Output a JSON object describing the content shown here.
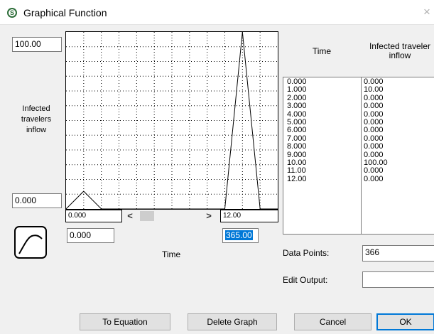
{
  "window": {
    "title": "Graphical Function",
    "app_icon_glyph": "S",
    "app_icon_name": "stella-s-icon",
    "close_glyph": "×"
  },
  "graph": {
    "y_max": "100.00",
    "y_min": "0.000",
    "y_label": "Infected travelers inflow",
    "x_label": "Time",
    "x_min_field": "0.000",
    "x_max_field": "365.00",
    "scroll_left_value": "0.000",
    "scroll_right_value": "12.00",
    "scroll_left_arrow": "<",
    "scroll_right_arrow": ">"
  },
  "table": {
    "col_time": "Time",
    "col_value": "Infected traveler inflow",
    "rows": [
      {
        "time": "0.000",
        "value": "0.000"
      },
      {
        "time": "1.000",
        "value": "10.00"
      },
      {
        "time": "2.000",
        "value": "0.000"
      },
      {
        "time": "3.000",
        "value": "0.000"
      },
      {
        "time": "4.000",
        "value": "0.000"
      },
      {
        "time": "5.000",
        "value": "0.000"
      },
      {
        "time": "6.000",
        "value": "0.000"
      },
      {
        "time": "7.000",
        "value": "0.000"
      },
      {
        "time": "8.000",
        "value": "0.000"
      },
      {
        "time": "9.000",
        "value": "0.000"
      },
      {
        "time": "10.00",
        "value": "100.00"
      },
      {
        "time": "11.00",
        "value": "0.000"
      },
      {
        "time": "12.00",
        "value": "0.000"
      }
    ]
  },
  "fields": {
    "data_points_label": "Data Points:",
    "data_points_value": "366",
    "edit_output_label": "Edit Output:",
    "edit_output_value": ""
  },
  "buttons": {
    "to_equation": "To Equation",
    "delete_graph": "Delete Graph",
    "cancel": "Cancel",
    "ok": "OK"
  },
  "chart_data": {
    "type": "line",
    "x": [
      0,
      1,
      2,
      3,
      4,
      5,
      6,
      7,
      8,
      9,
      10,
      11,
      12
    ],
    "series": [
      {
        "values": [
          0,
          10,
          0,
          0,
          0,
          0,
          0,
          0,
          0,
          0,
          100,
          0,
          0
        ]
      }
    ],
    "xlim": [
      0,
      12
    ],
    "ylim": [
      0,
      100
    ],
    "grid": true
  }
}
